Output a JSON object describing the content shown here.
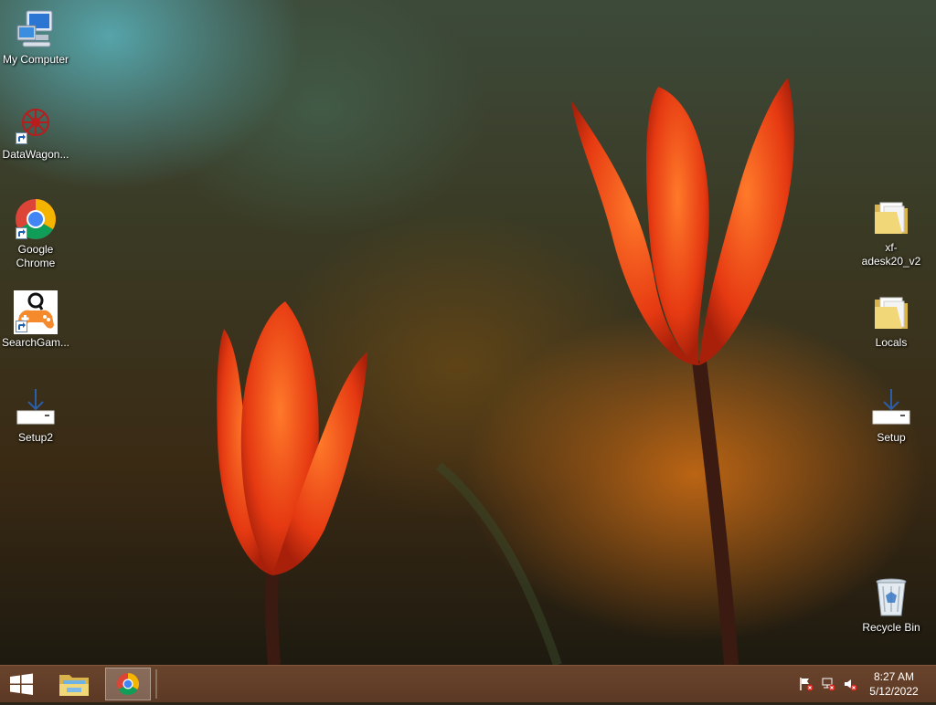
{
  "desktop": {
    "left_icons": [
      {
        "label": "My Computer",
        "icon": "computer-icon"
      },
      {
        "label": "DataWagon...",
        "icon": "datawagon-icon"
      },
      {
        "label": "Google Chrome",
        "icon": "chrome-icon"
      },
      {
        "label": "SearchGam...",
        "icon": "searchgames-icon"
      },
      {
        "label": "Setup2",
        "icon": "installer-icon"
      }
    ],
    "right_icons": [
      {
        "label": "xf-adesk20_v2",
        "icon": "folder-icon"
      },
      {
        "label": "Locals",
        "icon": "folder-icon"
      },
      {
        "label": "Setup",
        "icon": "installer-icon"
      },
      {
        "label": "Recycle Bin",
        "icon": "recycle-bin-icon"
      }
    ]
  },
  "taskbar": {
    "start": "windows-logo-icon",
    "pinned": [
      "file-explorer-icon",
      "chrome-icon"
    ],
    "tray": [
      "action-center-flag-icon",
      "network-icon",
      "volume-muted-icon"
    ],
    "clock": {
      "time": "8:27 AM",
      "date": "5/12/2022"
    }
  },
  "colors": {
    "taskbar": "#6b4530",
    "accent": "#e2521c"
  }
}
